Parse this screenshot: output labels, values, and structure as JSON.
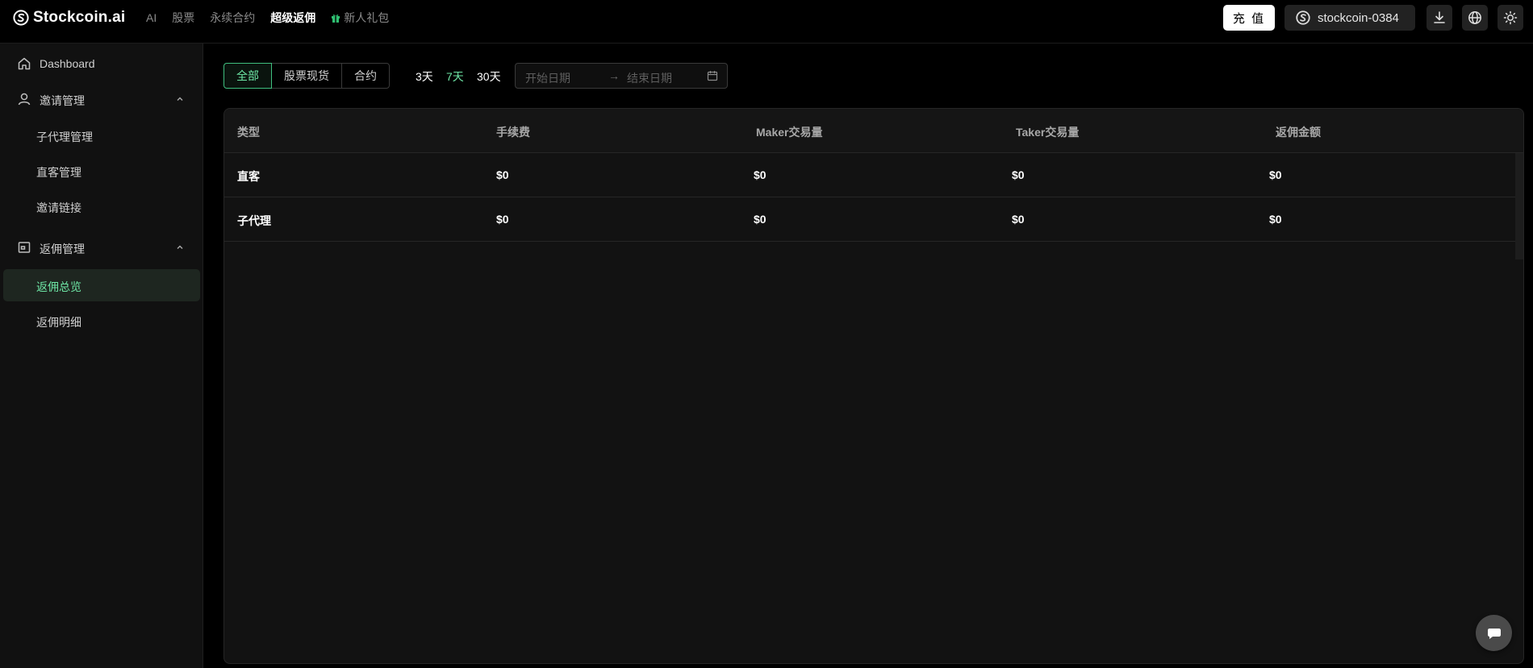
{
  "app": {
    "name": "Stockcoin.ai"
  },
  "nav": [
    {
      "label": "AI",
      "active": false
    },
    {
      "label": "股票",
      "active": false
    },
    {
      "label": "永续合约",
      "active": false
    },
    {
      "label": "超级返佣",
      "active": true
    },
    {
      "label": "新人礼包",
      "active": false,
      "icon": "gift-icon"
    }
  ],
  "header": {
    "recharge_label": "充 值",
    "account_name": "stockcoin-0384",
    "icons": [
      "download-icon",
      "globe-icon",
      "sun-icon"
    ]
  },
  "sidebar": {
    "dashboard": "Dashboard",
    "invite_group": "邀请管理",
    "invite_items": [
      "子代理管理",
      "直客管理",
      "邀请链接"
    ],
    "rebate_group": "返佣管理",
    "rebate_items": [
      "返佣总览",
      "返佣明细"
    ],
    "active_item": "返佣总览"
  },
  "filters": {
    "segments": [
      "全部",
      "股票现货",
      "合约"
    ],
    "active_segment": "全部",
    "quick_ranges": [
      "3天",
      "7天",
      "30天"
    ],
    "active_range": "7天",
    "start_placeholder": "开始日期",
    "end_placeholder": "结束日期",
    "arrow": "→"
  },
  "table": {
    "columns": [
      "类型",
      "手续费",
      "Maker交易量",
      "Taker交易量",
      "返佣金额"
    ],
    "rows": [
      [
        "直客",
        "$0",
        "$0",
        "$0",
        "$0"
      ],
      [
        "子代理",
        "$0",
        "$0",
        "$0",
        "$0"
      ]
    ]
  },
  "colors": {
    "accent": "#6ee7a6",
    "background": "#000000",
    "panel": "#121212",
    "gift": "#2fbf71"
  }
}
